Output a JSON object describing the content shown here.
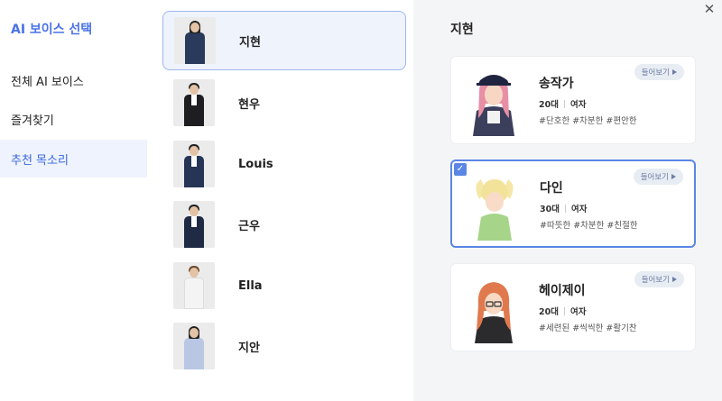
{
  "sidebar": {
    "title": "AI 보이스 선택",
    "items": [
      {
        "label": "전체 AI 보이스"
      },
      {
        "label": "즐겨찾기"
      },
      {
        "label": "추천 목소리"
      }
    ]
  },
  "avatars": [
    {
      "name": "지현"
    },
    {
      "name": "현우"
    },
    {
      "name": "Louis"
    },
    {
      "name": "근우"
    },
    {
      "name": "Ella"
    },
    {
      "name": "지안"
    }
  ],
  "panel": {
    "title": "지현",
    "close_icon": "close-icon",
    "listen_label": "들어보기",
    "voices": [
      {
        "name": "송작가",
        "age": "20대",
        "gender": "여자",
        "tags": "#단호한 #차분한 #편안한"
      },
      {
        "name": "다인",
        "age": "30대",
        "gender": "여자",
        "tags": "#따뜻한 #차분한 #친절한"
      },
      {
        "name": "헤이제이",
        "age": "20대",
        "gender": "여자",
        "tags": "#세련된 #씩씩한 #활기찬"
      }
    ]
  },
  "colors": {
    "accent": "#4a72e8",
    "selected_border": "#5b86e5",
    "panel_bg": "#f4f5f7"
  }
}
